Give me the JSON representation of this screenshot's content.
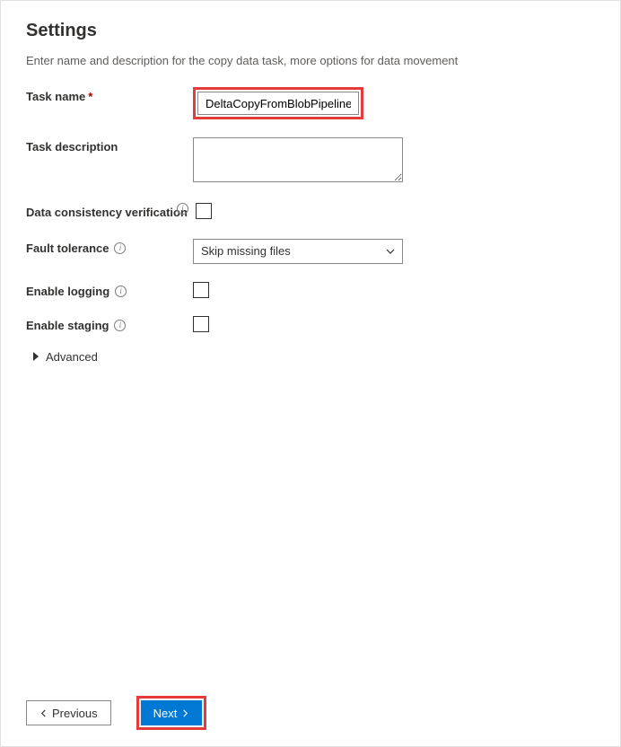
{
  "header": {
    "title": "Settings",
    "subtitle": "Enter name and description for the copy data task, more options for data movement"
  },
  "form": {
    "task_name_label": "Task name",
    "task_name_value": "DeltaCopyFromBlobPipeline",
    "task_desc_label": "Task description",
    "task_desc_value": "",
    "dcv_label": "Data consistency verification",
    "fault_tolerance_label": "Fault tolerance",
    "fault_tolerance_value": "Skip missing files",
    "enable_logging_label": "Enable logging",
    "enable_staging_label": "Enable staging",
    "advanced_label": "Advanced"
  },
  "footer": {
    "previous_label": "Previous",
    "next_label": "Next"
  }
}
